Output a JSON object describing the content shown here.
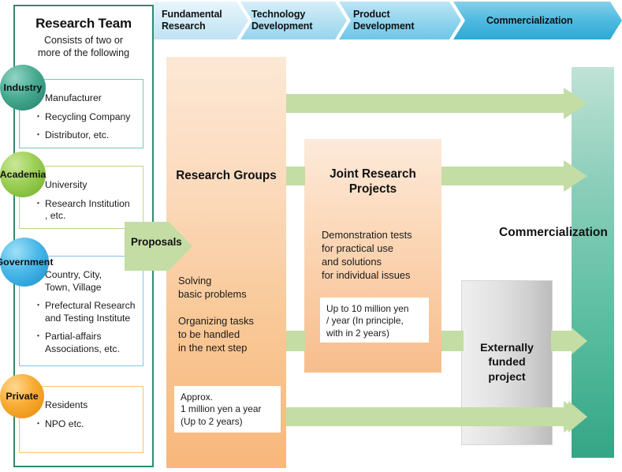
{
  "header": {
    "stages": [
      {
        "label": "Fundamental\nResearch",
        "color": "#d9effa"
      },
      {
        "label": "Technology\nDevelopment",
        "color": "#b6e2f3"
      },
      {
        "label": "Product\nDevelopment",
        "color": "#8fd4ec"
      },
      {
        "label": "Commercialization",
        "color": "#46b6dd"
      }
    ]
  },
  "team_panel": {
    "title": "Research Team",
    "subtitle": "Consists of two or\nmore of the following",
    "border_color": "#2e8b72",
    "groups": [
      {
        "name": "Industry",
        "bubble_color": "#2e9e86",
        "box_border": "#7fc2b2",
        "items": [
          "Manufacturer",
          "Recycling Company",
          "Distributor, etc."
        ]
      },
      {
        "name": "Academia",
        "bubble_color": "#8cc63e",
        "box_border": "#b5d98a",
        "items": [
          "University",
          "Research Institution\n, etc."
        ]
      },
      {
        "name": "Government",
        "bubble_color": "#3fb5e8",
        "box_border": "#7fc4e8",
        "items": [
          "Country, City,\nTown, Village",
          "Prefectural Research\nand Testing Institute",
          "Partial-affairs\nAssociations, etc."
        ]
      },
      {
        "name": "Private",
        "bubble_color": "#f5a11e",
        "box_border": "#f5c179",
        "items": [
          "Residents",
          "NPO etc."
        ]
      }
    ]
  },
  "proposals": {
    "label": "Proposals",
    "color": "#c3dda4"
  },
  "columns": {
    "research_groups": {
      "title": "Research Groups",
      "body": "Solving\nbasic problems\n\nOrganizing tasks\nto be handled\nin the next step",
      "note": "Approx.\n1 million yen a year\n(Up to 2 years)",
      "color": "#f9c497"
    },
    "joint_research": {
      "title": "Joint Research\nProjects",
      "body": "Demonstration tests\nfor practical use\nand solutions\nfor individual issues",
      "note": "Up to 10 million yen\n/ year (In principle,\nwith in 2 years)",
      "color": "#f8c79c"
    },
    "externally_funded": {
      "title": "Externally\nfunded\nproject",
      "color": "#cfcfcf"
    },
    "commercialization": {
      "title": "Commercialization",
      "color": "#4db79a"
    }
  },
  "arrows": {
    "color": "#c3dda4",
    "flows": [
      {
        "name": "research-to-commercialization",
        "from": "research_groups",
        "to": "commercialization"
      },
      {
        "name": "joint-to-commercialization",
        "from": "joint_research",
        "to": "commercialization"
      },
      {
        "name": "research-to-joint",
        "from": "research_groups",
        "to": "joint_research"
      },
      {
        "name": "joint-to-external",
        "from": "joint_research",
        "to": "externally_funded"
      },
      {
        "name": "external-to-commercialization",
        "from": "externally_funded",
        "to": "commercialization"
      },
      {
        "name": "research-to-external",
        "from": "research_groups",
        "to": "externally_funded"
      },
      {
        "name": "external-bottom-to-commercialization",
        "from": "externally_funded",
        "to": "commercialization"
      }
    ]
  }
}
